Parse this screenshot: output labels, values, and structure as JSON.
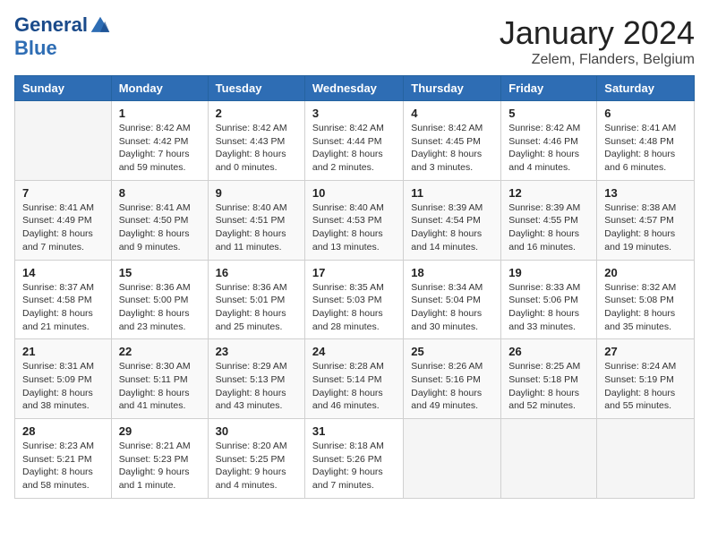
{
  "header": {
    "logo_line1": "General",
    "logo_line2": "Blue",
    "main_title": "January 2024",
    "subtitle": "Zelem, Flanders, Belgium"
  },
  "days_of_week": [
    "Sunday",
    "Monday",
    "Tuesday",
    "Wednesday",
    "Thursday",
    "Friday",
    "Saturday"
  ],
  "weeks": [
    [
      {
        "day": "",
        "detail": ""
      },
      {
        "day": "1",
        "detail": "Sunrise: 8:42 AM\nSunset: 4:42 PM\nDaylight: 7 hours\nand 59 minutes."
      },
      {
        "day": "2",
        "detail": "Sunrise: 8:42 AM\nSunset: 4:43 PM\nDaylight: 8 hours\nand 0 minutes."
      },
      {
        "day": "3",
        "detail": "Sunrise: 8:42 AM\nSunset: 4:44 PM\nDaylight: 8 hours\nand 2 minutes."
      },
      {
        "day": "4",
        "detail": "Sunrise: 8:42 AM\nSunset: 4:45 PM\nDaylight: 8 hours\nand 3 minutes."
      },
      {
        "day": "5",
        "detail": "Sunrise: 8:42 AM\nSunset: 4:46 PM\nDaylight: 8 hours\nand 4 minutes."
      },
      {
        "day": "6",
        "detail": "Sunrise: 8:41 AM\nSunset: 4:48 PM\nDaylight: 8 hours\nand 6 minutes."
      }
    ],
    [
      {
        "day": "7",
        "detail": "Sunrise: 8:41 AM\nSunset: 4:49 PM\nDaylight: 8 hours\nand 7 minutes."
      },
      {
        "day": "8",
        "detail": "Sunrise: 8:41 AM\nSunset: 4:50 PM\nDaylight: 8 hours\nand 9 minutes."
      },
      {
        "day": "9",
        "detail": "Sunrise: 8:40 AM\nSunset: 4:51 PM\nDaylight: 8 hours\nand 11 minutes."
      },
      {
        "day": "10",
        "detail": "Sunrise: 8:40 AM\nSunset: 4:53 PM\nDaylight: 8 hours\nand 13 minutes."
      },
      {
        "day": "11",
        "detail": "Sunrise: 8:39 AM\nSunset: 4:54 PM\nDaylight: 8 hours\nand 14 minutes."
      },
      {
        "day": "12",
        "detail": "Sunrise: 8:39 AM\nSunset: 4:55 PM\nDaylight: 8 hours\nand 16 minutes."
      },
      {
        "day": "13",
        "detail": "Sunrise: 8:38 AM\nSunset: 4:57 PM\nDaylight: 8 hours\nand 19 minutes."
      }
    ],
    [
      {
        "day": "14",
        "detail": "Sunrise: 8:37 AM\nSunset: 4:58 PM\nDaylight: 8 hours\nand 21 minutes."
      },
      {
        "day": "15",
        "detail": "Sunrise: 8:36 AM\nSunset: 5:00 PM\nDaylight: 8 hours\nand 23 minutes."
      },
      {
        "day": "16",
        "detail": "Sunrise: 8:36 AM\nSunset: 5:01 PM\nDaylight: 8 hours\nand 25 minutes."
      },
      {
        "day": "17",
        "detail": "Sunrise: 8:35 AM\nSunset: 5:03 PM\nDaylight: 8 hours\nand 28 minutes."
      },
      {
        "day": "18",
        "detail": "Sunrise: 8:34 AM\nSunset: 5:04 PM\nDaylight: 8 hours\nand 30 minutes."
      },
      {
        "day": "19",
        "detail": "Sunrise: 8:33 AM\nSunset: 5:06 PM\nDaylight: 8 hours\nand 33 minutes."
      },
      {
        "day": "20",
        "detail": "Sunrise: 8:32 AM\nSunset: 5:08 PM\nDaylight: 8 hours\nand 35 minutes."
      }
    ],
    [
      {
        "day": "21",
        "detail": "Sunrise: 8:31 AM\nSunset: 5:09 PM\nDaylight: 8 hours\nand 38 minutes."
      },
      {
        "day": "22",
        "detail": "Sunrise: 8:30 AM\nSunset: 5:11 PM\nDaylight: 8 hours\nand 41 minutes."
      },
      {
        "day": "23",
        "detail": "Sunrise: 8:29 AM\nSunset: 5:13 PM\nDaylight: 8 hours\nand 43 minutes."
      },
      {
        "day": "24",
        "detail": "Sunrise: 8:28 AM\nSunset: 5:14 PM\nDaylight: 8 hours\nand 46 minutes."
      },
      {
        "day": "25",
        "detail": "Sunrise: 8:26 AM\nSunset: 5:16 PM\nDaylight: 8 hours\nand 49 minutes."
      },
      {
        "day": "26",
        "detail": "Sunrise: 8:25 AM\nSunset: 5:18 PM\nDaylight: 8 hours\nand 52 minutes."
      },
      {
        "day": "27",
        "detail": "Sunrise: 8:24 AM\nSunset: 5:19 PM\nDaylight: 8 hours\nand 55 minutes."
      }
    ],
    [
      {
        "day": "28",
        "detail": "Sunrise: 8:23 AM\nSunset: 5:21 PM\nDaylight: 8 hours\nand 58 minutes."
      },
      {
        "day": "29",
        "detail": "Sunrise: 8:21 AM\nSunset: 5:23 PM\nDaylight: 9 hours\nand 1 minute."
      },
      {
        "day": "30",
        "detail": "Sunrise: 8:20 AM\nSunset: 5:25 PM\nDaylight: 9 hours\nand 4 minutes."
      },
      {
        "day": "31",
        "detail": "Sunrise: 8:18 AM\nSunset: 5:26 PM\nDaylight: 9 hours\nand 7 minutes."
      },
      {
        "day": "",
        "detail": ""
      },
      {
        "day": "",
        "detail": ""
      },
      {
        "day": "",
        "detail": ""
      }
    ]
  ]
}
